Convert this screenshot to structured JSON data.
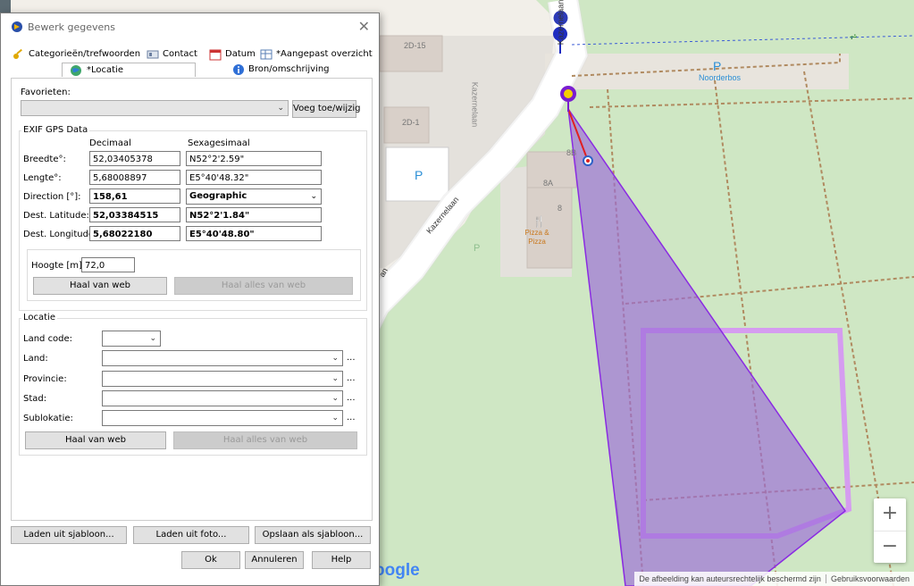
{
  "dialog": {
    "title": "Bewerk gegevens",
    "close_glyph": "✕",
    "tabs_row1": [
      {
        "label": "Categorieën/trefwoorden",
        "icon": "key-icon"
      },
      {
        "label": "Contact",
        "icon": "contact-card-icon"
      },
      {
        "label": "Datum",
        "icon": "calendar-icon"
      },
      {
        "label": "*Aangepast overzicht",
        "icon": "table-icon"
      }
    ],
    "tabs_row2": [
      {
        "label": "*Locatie",
        "icon": "globe-icon",
        "active": true
      },
      {
        "label": "Bron/omschrijving",
        "icon": "info-icon"
      }
    ],
    "favorites": {
      "label": "Favorieten:",
      "value": "",
      "add_button": "Voeg toe/wijzig"
    },
    "exif": {
      "group_title": "EXIF GPS Data",
      "col_decimal": "Decimaal",
      "col_sexagesimal": "Sexagesimaal",
      "rows": [
        {
          "label": "Breedte°:",
          "decimal": "52,03405378",
          "sexagesimal": "N52°2'2.59\"",
          "bold": false
        },
        {
          "label": "Lengte°:",
          "decimal": "5,68008897",
          "sexagesimal": "E5°40'48.32\"",
          "bold": false
        },
        {
          "label": "Direction [°]:",
          "decimal": "158,61",
          "sexagesimal": "Geographic",
          "bold": true
        },
        {
          "label": "Dest. Latitude:",
          "decimal": "52,03384515",
          "sexagesimal": "N52°2'1.84\"",
          "bold": true
        },
        {
          "label": "Dest. Longitude:",
          "decimal": "5,68022180",
          "sexagesimal": "E5°40'48.80\"",
          "bold": true
        }
      ],
      "height_label": "Hoogte [m]:",
      "height_value": "72,0",
      "get_web": "Haal van web",
      "get_all_web": "Haal alles van web"
    },
    "location": {
      "group_title": "Locatie",
      "land_code_label": "Land code:",
      "fields": [
        {
          "label": "Land:",
          "value": ""
        },
        {
          "label": "Provincie:",
          "value": ""
        },
        {
          "label": "Stad:",
          "value": ""
        },
        {
          "label": "Sublokatie:",
          "value": ""
        }
      ],
      "ellipsis": "...",
      "get_web": "Haal van web",
      "get_all_web": "Haal alles van web"
    },
    "bottom": {
      "load_template": "Laden uit sjabloon...",
      "load_photo": "Laden uit foto...",
      "save_template": "Opslaan als sjabloon...",
      "ok": "Ok",
      "cancel": "Annuleren",
      "help": "Help"
    }
  },
  "map": {
    "labels": {
      "street1": "Kazernelaan",
      "street2": "Kazernelaan",
      "street3": "Kazernelaan",
      "street_partial": "an",
      "building_2d15": "2D-15",
      "building_2d1": "2D-1",
      "building_8a": "8A",
      "building_8": "8",
      "building_8b": "8B",
      "parking_p1": "P",
      "parking_p2": "P",
      "parking_p3": "P",
      "park_name": "Noorderbos",
      "restaurant": "Pizza & Pizza"
    },
    "zoom_in": "+",
    "zoom_out": "−",
    "google": "oogle",
    "attribution": [
      "De afbeelding kan auteursrechtelijk beschermd zijn",
      "Gebruiksvoorwaarden"
    ],
    "colors": {
      "sector_fill": "#9b6ad8",
      "sector_stroke": "#8a2be2",
      "forest": "#cfe7c4",
      "road": "#ffffff"
    }
  }
}
